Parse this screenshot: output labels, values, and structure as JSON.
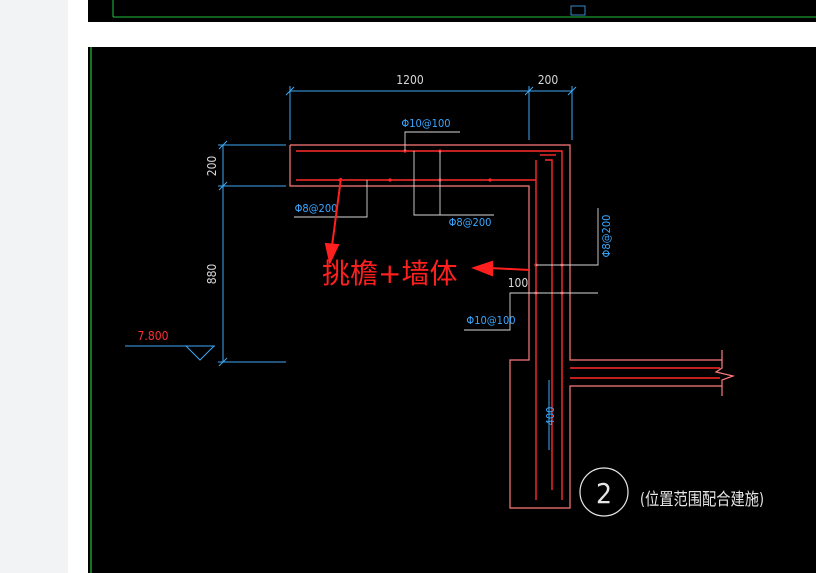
{
  "drawing": {
    "dims": {
      "top_width_1": "1200",
      "top_width_2": "200",
      "slab_thickness": "200",
      "parapet_height": "880",
      "small_dim": "100",
      "column_width": "400"
    },
    "rebar_labels": {
      "top_main": "Φ10@100",
      "bottom_left": "Φ8@200",
      "bottom_mid": "Φ8@200",
      "column_right": "Φ8@200",
      "column_mid": "Φ10@100"
    },
    "elevation": "7.800",
    "annotation": "挑檐+墙体",
    "detail_number": "2",
    "detail_note": "(位置范围配合建施)"
  },
  "colors": {
    "background": "#000000",
    "dimension": "#3fa9f5",
    "rebar": "#ff2b2b",
    "outline": "#ff7a7a",
    "frame": "#22c13a",
    "annotation": "#ff1f1f",
    "elevation": "#ff3030"
  }
}
